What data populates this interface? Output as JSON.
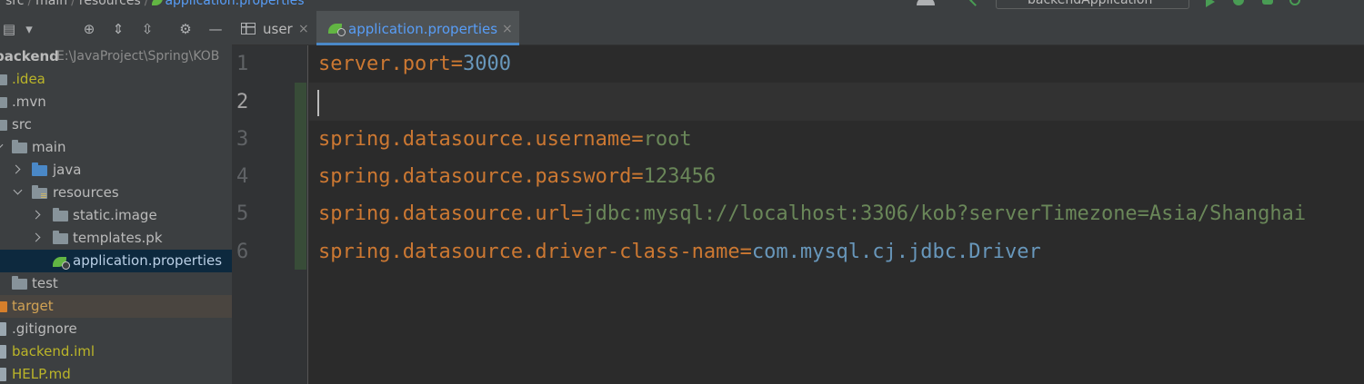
{
  "breadcrumb": {
    "items": [
      "src",
      "main",
      "resources",
      "application.properties"
    ]
  },
  "run_config": {
    "label": "backendApplication"
  },
  "project_tree": {
    "root_name": "backend",
    "root_path": "E:\\JavaProject\\Spring\\KOB",
    "items": [
      {
        "label": ".idea"
      },
      {
        "label": ".mvn"
      },
      {
        "label": "src"
      },
      {
        "label": "main"
      },
      {
        "label": "java"
      },
      {
        "label": "resources"
      },
      {
        "label": "static.image"
      },
      {
        "label": "templates.pk"
      },
      {
        "label": "application.properties"
      },
      {
        "label": "test"
      },
      {
        "label": "target"
      },
      {
        "label": ".gitignore"
      },
      {
        "label": "backend.iml"
      },
      {
        "label": "HELP.md"
      }
    ]
  },
  "tabs": [
    {
      "label": "user",
      "close": "×"
    },
    {
      "label": "application.properties",
      "close": "×"
    }
  ],
  "editor": {
    "line_numbers": [
      "1",
      "2",
      "3",
      "4",
      "5",
      "6"
    ],
    "lines": [
      {
        "key": "server.port",
        "eq": "=",
        "value": "3000"
      },
      {
        "key": "",
        "eq": "",
        "value": ""
      },
      {
        "key": "spring.datasource.username",
        "eq": "=",
        "value": "root"
      },
      {
        "key": "spring.datasource.password",
        "eq": "=",
        "value": "123456"
      },
      {
        "key": "spring.datasource.url",
        "eq": "=",
        "value": "jdbc:mysql://localhost:3306/kob?serverTimezone=Asia/Shanghai"
      },
      {
        "key": "spring.datasource.driver-class-name",
        "eq": "=",
        "value": "com.mysql.cj.jdbc.Driver"
      }
    ]
  },
  "colors": {
    "key": "#cc7832",
    "string_value": "#6a8759",
    "number_value": "#6897bb",
    "selection": "#0d293e",
    "tab_underline": "#4a88c7"
  }
}
